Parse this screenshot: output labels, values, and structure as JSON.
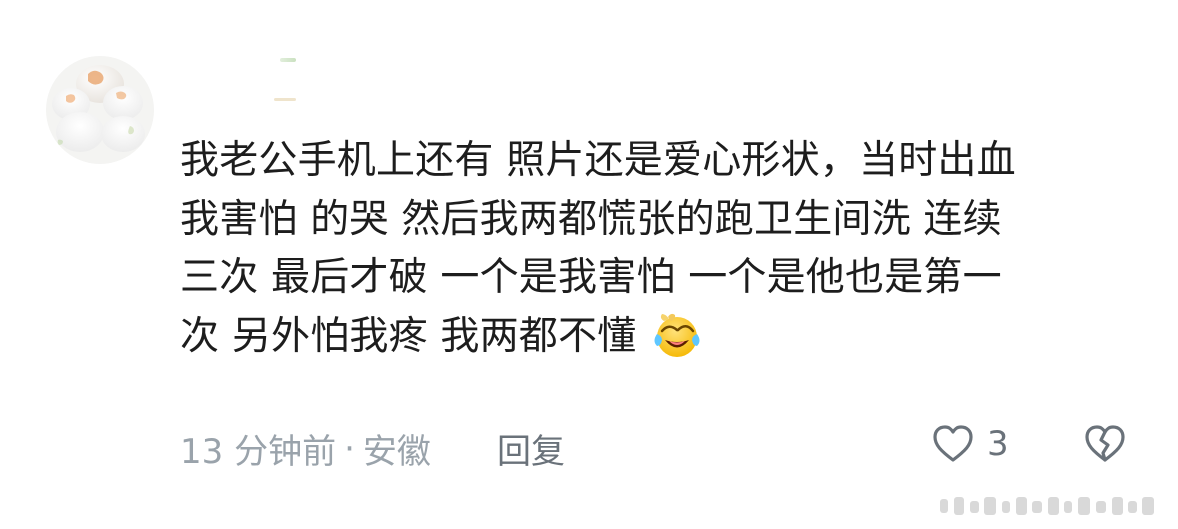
{
  "comment": {
    "username": "",
    "avatar": "avatar-image",
    "text_lines": [
      "我老公手机上还有 照片还是爱心形状，当时出血",
      "我害怕 的哭 然后我两都慌张的跑卫生间洗  连续",
      "三次 最后才破 一个是我害怕 一个是他也是第一",
      "次  另外怕我疼 我两都不懂"
    ],
    "emoji": "laughing-crying-face-emoji",
    "meta": {
      "time": "13 分钟前",
      "separator": "·",
      "location": "安徽"
    },
    "reply_label": "回复",
    "likes": "3"
  },
  "icons": {
    "like": "heart-icon",
    "dislike": "broken-heart-icon"
  },
  "colors": {
    "text": "#1d1d1d",
    "meta": "#9aa3ab",
    "icon": "#6a727a"
  }
}
